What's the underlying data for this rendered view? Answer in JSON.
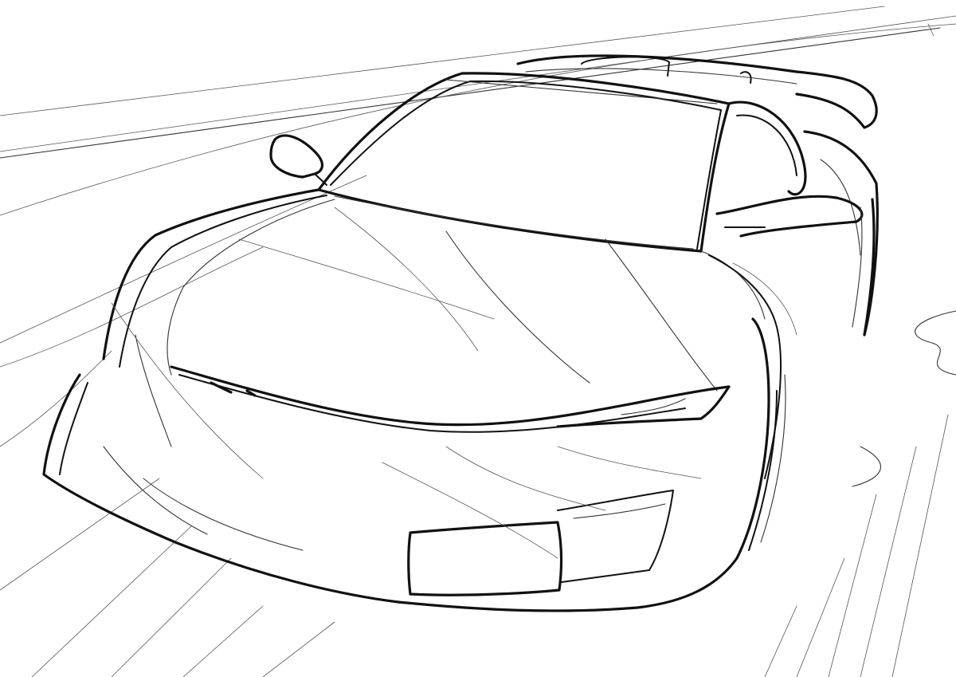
{
  "artwork": {
    "subject_icon": "car-sketch-icon",
    "palette": {
      "background": "#ffffff",
      "ink": "#111111",
      "sketch": "#333333",
      "speed_lines": "#555555"
    },
    "license_plate_text": ""
  }
}
